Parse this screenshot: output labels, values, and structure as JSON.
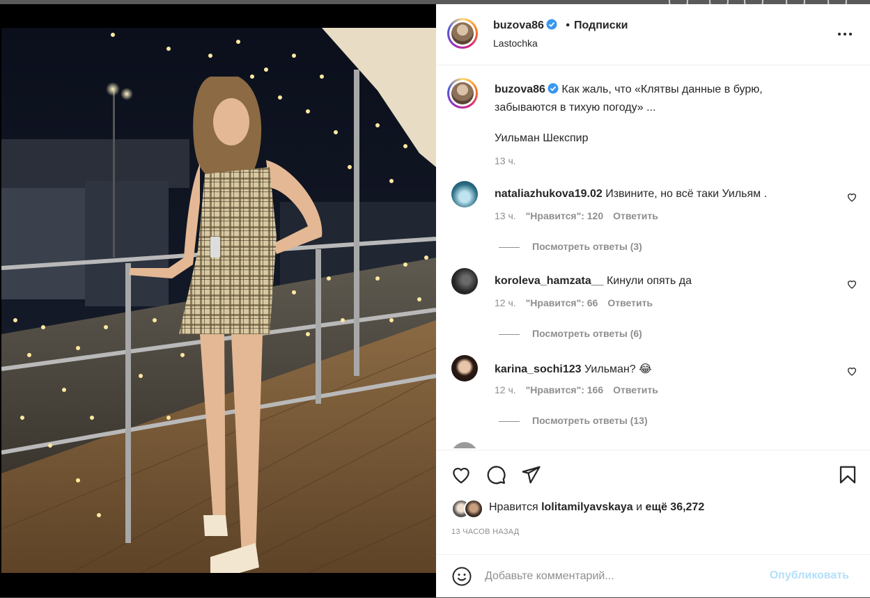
{
  "post": {
    "username": "buzova86",
    "follow_label": "Подписки",
    "separator": "•",
    "location": "Lastochka",
    "caption": "Как жаль, что «Клятвы данные в бурю, забываются в тихую погоду» ...",
    "caption_author": "Уильман Шекспир",
    "caption_time": "13 ч."
  },
  "comments": [
    {
      "username": "nataliazhukova19.02",
      "text": "Извините, но всё таки Уильям .",
      "time": "13 ч.",
      "likes_label": "\"Нравится\": 120",
      "reply_label": "Ответить",
      "replies_label": "Посмотреть ответы (3)"
    },
    {
      "username": "koroleva_hamzata__",
      "text": "Кинули опять да",
      "time": "12 ч.",
      "likes_label": "\"Нравится\": 66",
      "reply_label": "Ответить",
      "replies_label": "Посмотреть ответы (6)"
    },
    {
      "username": "karina_sochi123",
      "text": "Уильман? 😂",
      "time": "12 ч.",
      "likes_label": "\"Нравится\": 166",
      "reply_label": "Ответить",
      "replies_label": "Посмотреть ответы (13)"
    }
  ],
  "likes": {
    "prefix": "Нравится",
    "user": "lolitamilyavskaya",
    "conj": "и",
    "rest": "ещё 36,272"
  },
  "posted_ago": "13 ЧАСОВ НАЗАД",
  "composer": {
    "placeholder": "Добавьте комментарий...",
    "publish_label": "Опубликовать"
  },
  "colors": {
    "accent_disabled": "#b2dffc",
    "verified": "#3897f0",
    "secondary_text": "#8e8e8e"
  },
  "icons": [
    "more-options-icon",
    "verified-badge-icon",
    "heart-icon",
    "comment-icon",
    "share-icon",
    "bookmark-icon",
    "emoji-icon"
  ]
}
